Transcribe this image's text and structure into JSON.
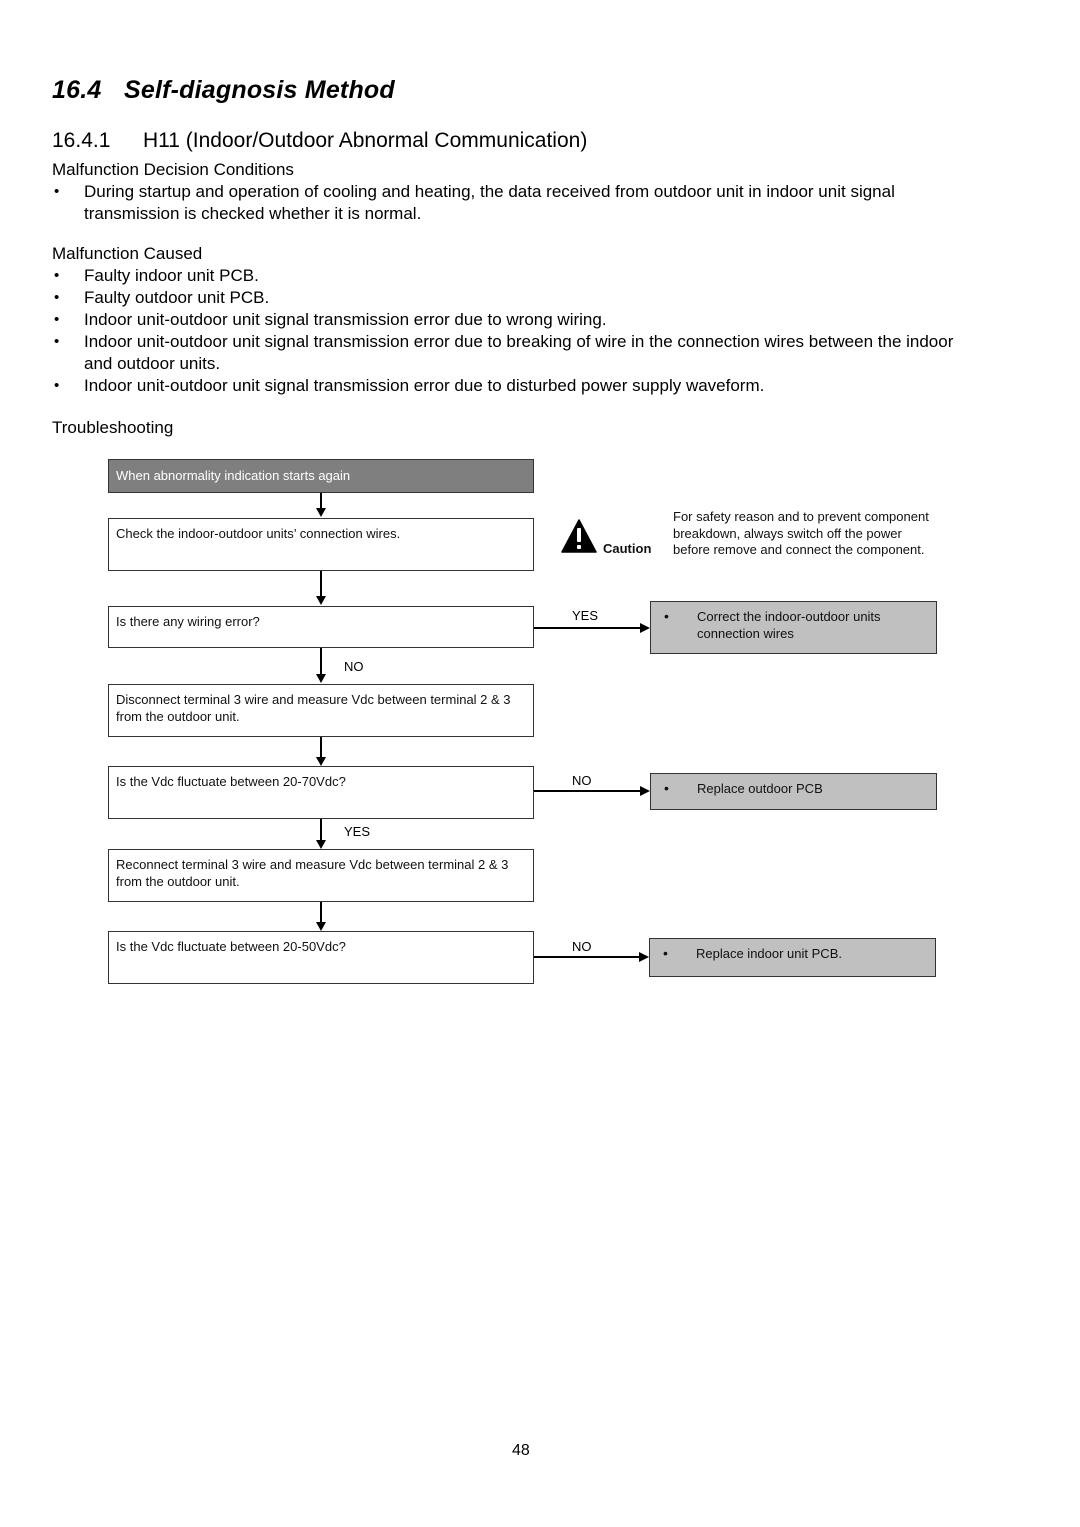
{
  "section": {
    "number": "16.4",
    "title": "Self-diagnosis Method"
  },
  "subsection": {
    "number": "16.4.1",
    "title": "H11 (Indoor/Outdoor Abnormal Communication)"
  },
  "decision_conditions": {
    "heading": "Malfunction Decision Conditions",
    "items": [
      "During startup and operation of cooling and heating, the data received from outdoor unit in indoor unit signal transmission is checked whether it is normal."
    ]
  },
  "causes": {
    "heading": "Malfunction Caused",
    "items": [
      "Faulty indoor unit PCB.",
      "Faulty outdoor unit PCB.",
      "Indoor unit-outdoor unit signal transmission error due to wrong wiring.",
      "Indoor unit-outdoor unit signal transmission error due to breaking of wire in the connection wires between the indoor and outdoor units.",
      "Indoor unit-outdoor unit signal transmission error due to disturbed power supply waveform."
    ]
  },
  "troubleshooting": {
    "heading": "Troubleshooting",
    "start": "When abnormality indication starts again",
    "steps": [
      "Check the indoor-outdoor units’ connection wires.",
      "Is there any wiring error?",
      "Disconnect terminal 3 wire and measure Vdc between terminal 2 & 3 from the outdoor unit.",
      "Is the Vdc fluctuate between 20-70Vdc?",
      "Reconnect terminal 3 wire and measure Vdc between terminal 2 & 3 from the outdoor unit.",
      "Is the Vdc fluctuate between 20-50Vdc?"
    ],
    "branch_labels": {
      "wiring_yes": "YES",
      "wiring_no": "NO",
      "vdc70_no": "NO",
      "vdc70_yes": "YES",
      "vdc50_no": "NO"
    },
    "actions": [
      "Correct the indoor-outdoor units connection wires",
      "Replace outdoor PCB",
      "Replace indoor unit PCB."
    ],
    "caution": {
      "label": "Caution",
      "text": "For safety reason and to prevent component breakdown, always switch off the power before remove and connect the component."
    }
  },
  "page_number": "48",
  "colors": {
    "start_box": "#7f7f7f",
    "action_box": "#c0c0c0",
    "border": "#333333"
  }
}
